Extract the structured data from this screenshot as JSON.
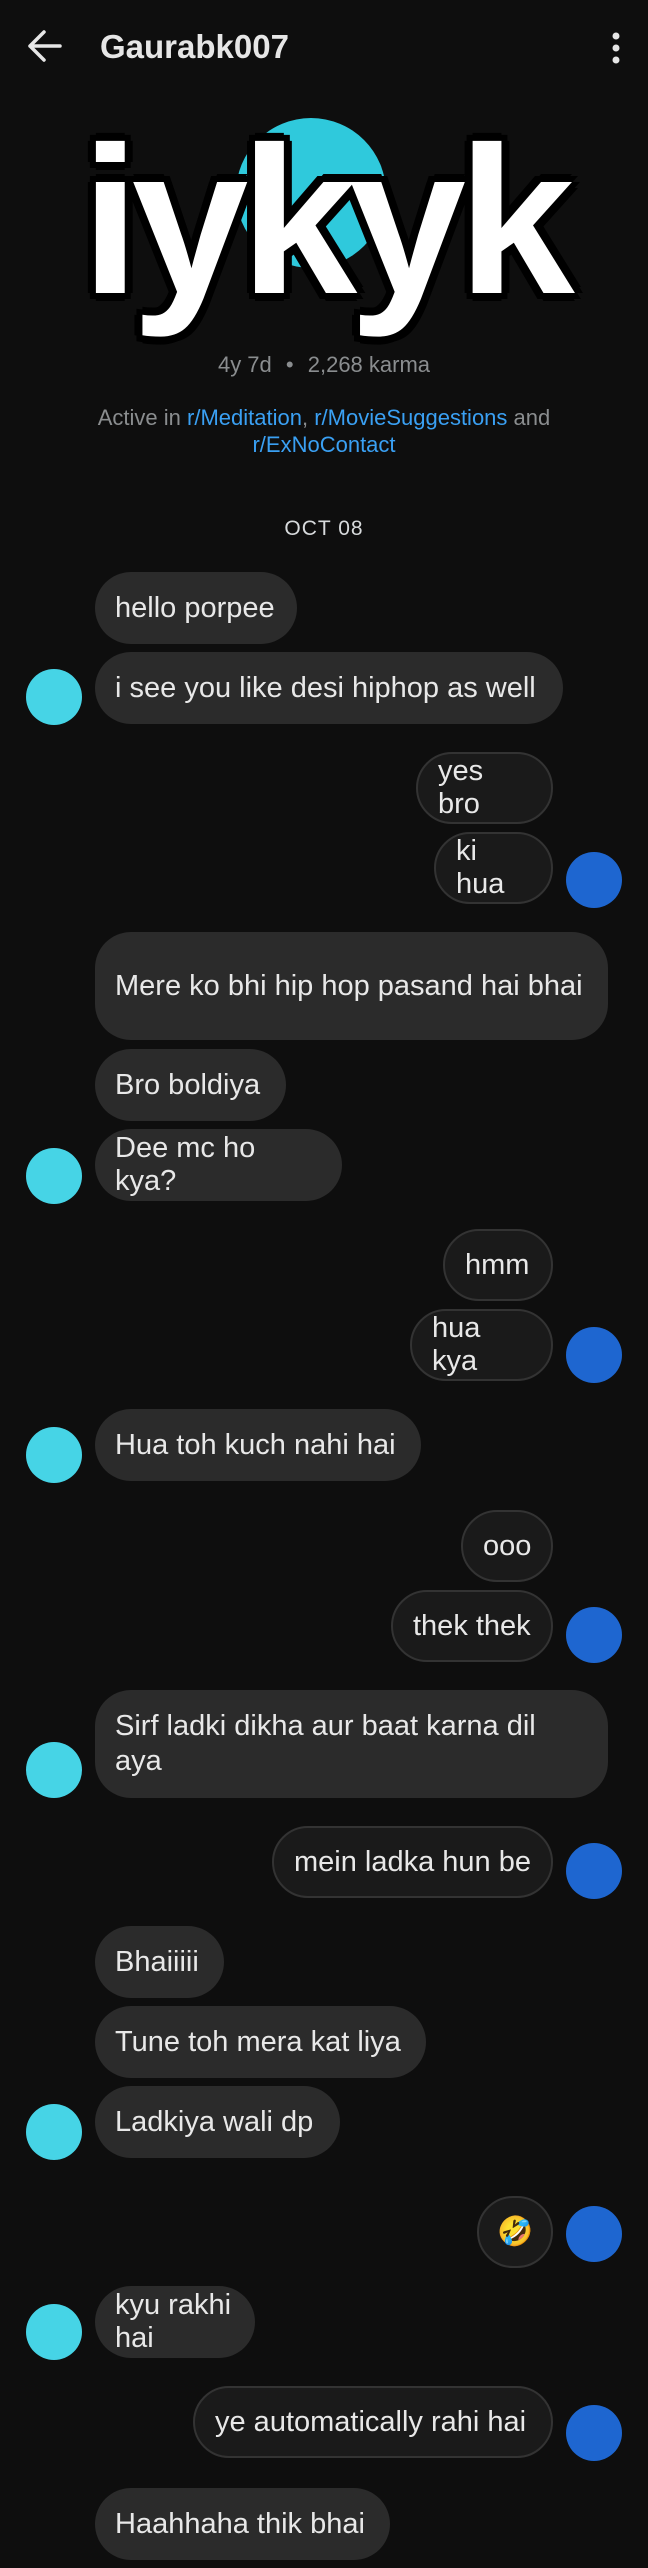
{
  "header": {
    "title": "Gaurabk007"
  },
  "profile": {
    "overlay_text": "iykyk",
    "age": "4y 7d",
    "dot": "•",
    "karma": "2,268 karma",
    "active_prefix": "Active in ",
    "active_links": [
      "r/Meditation",
      "r/MovieSuggestions",
      "r/ExNoContact"
    ],
    "sep1": ", ",
    "sep2": " and "
  },
  "date_separator": "OCT 08",
  "messages": [
    "hello porpee",
    "i see you like desi hiphop as well",
    "yes bro",
    "ki hua",
    "Mere ko bhi hip hop pasand hai bhai",
    "Bro boldiya",
    "Dee mc ho kya?",
    "hmm",
    "hua kya",
    "Hua toh kuch nahi hai",
    "ooo",
    "thek thek",
    "Sirf ladki dikha aur baat karna dil aya",
    "mein ladka hun be",
    "Bhaiiiii",
    "Tune toh mera kat liya",
    "Ladkiya wali dp",
    "🤣",
    "kyu rakhi hai",
    "ye automatically rahi hai",
    "Haahhaha thik bhai"
  ],
  "colors": {
    "background": "#0e0e0e",
    "bubble": "#2b2b2b",
    "link": "#3aa0f3",
    "snoo_avatar": "#46d4e6",
    "user_avatar": "#1e66d0"
  }
}
